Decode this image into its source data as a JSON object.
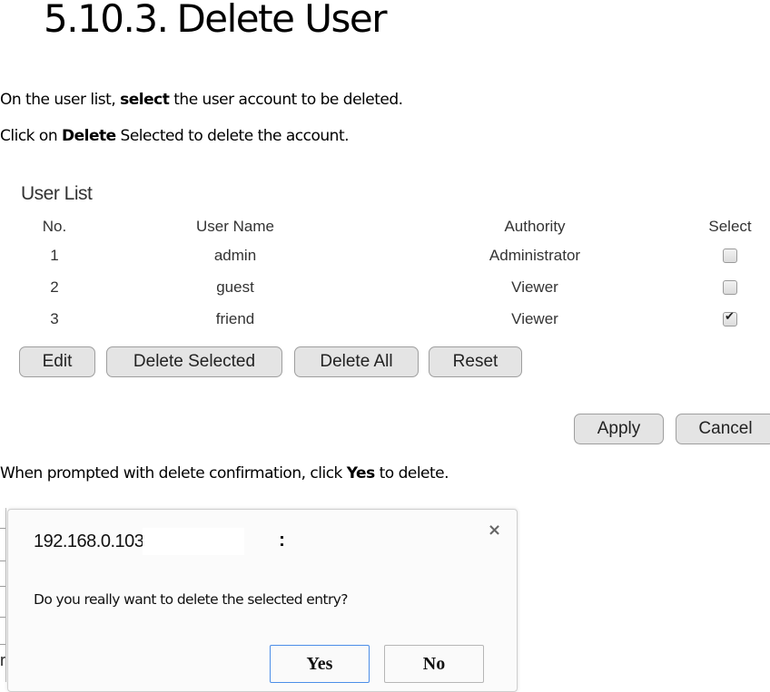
{
  "heading": {
    "number": "5.10.3.",
    "title": "Delete User"
  },
  "instructions": {
    "p1": {
      "pre": "On the user list, ",
      "bold": "select",
      "post": " the user account to be deleted."
    },
    "p2": {
      "pre": "Click on ",
      "bold": "Delete",
      "post": " Selected to delete the account."
    },
    "p3": {
      "pre": "When prompted with delete confirmation, click ",
      "bold": "Yes",
      "post": " to delete."
    }
  },
  "user_list": {
    "title": "User List",
    "columns": [
      "No.",
      "User Name",
      "Authority",
      "Select"
    ],
    "rows": [
      {
        "no": "1",
        "name": "admin",
        "authority": "Administrator",
        "selected": false
      },
      {
        "no": "2",
        "name": "guest",
        "authority": "Viewer",
        "selected": false
      },
      {
        "no": "3",
        "name": "friend",
        "authority": "Viewer",
        "selected": true
      }
    ],
    "buttons": {
      "edit": "Edit",
      "delete_selected": "Delete Selected",
      "delete_all": "Delete All",
      "reset": "Reset"
    }
  },
  "form_actions": {
    "apply": "Apply",
    "cancel": "Cancel"
  },
  "edge_fragment": "r",
  "dialog": {
    "host": "192.168.0.103",
    "colon": ":",
    "close_icon": "×",
    "message": "Do you really want to delete the selected entry?",
    "yes": "Yes",
    "no": "No",
    "focus_color": "#4c8ee8"
  }
}
